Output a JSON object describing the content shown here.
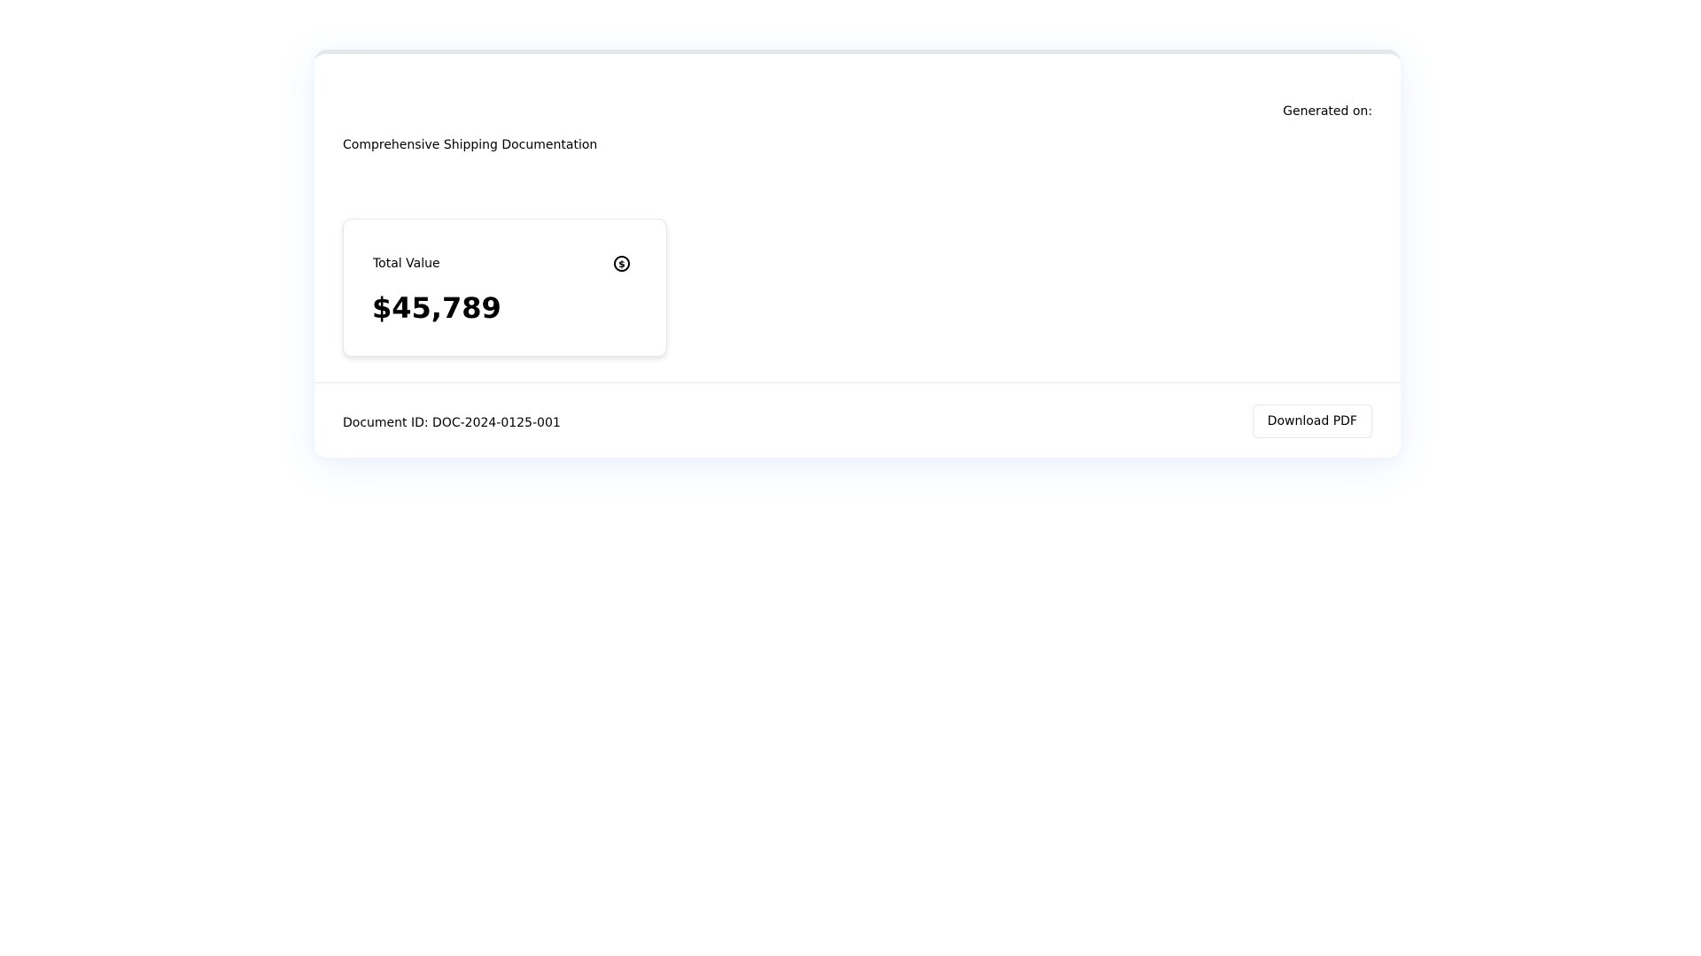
{
  "header": {
    "generated_on_label": "Generated on:",
    "subtitle": "Comprehensive Shipping Documentation"
  },
  "summary_card": {
    "label": "Total Value",
    "value": "$45,789",
    "icon": "dollar-circle-icon"
  },
  "footer": {
    "document_id": "Document ID: DOC-2024-0125-001",
    "download_label": "Download PDF"
  },
  "colors": {
    "border": "#e5e7eb",
    "text": "#000000",
    "shadow_tint": "#3b82f6"
  }
}
